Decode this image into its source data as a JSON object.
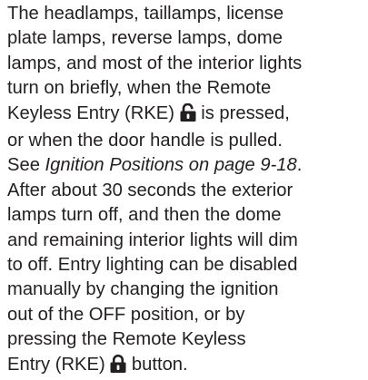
{
  "paragraph": {
    "lines": [
      "The headlamps, taillamps, license",
      "plate lamps, reverse lamps, dome",
      "lamps, and most of the interior lights",
      "turn on briefly, when the Remote",
      "Keyless Entry (RKE)",
      " is pressed,",
      "or when the door handle is pulled.",
      "See ",
      "Ignition Positions on page 9-18",
      ".",
      "After about 30 seconds the exterior",
      "lamps turn off, and then the dome",
      "and remaining interior lights will dim",
      "to off. Entry lighting can be disabled",
      "manually by changing the ignition",
      "out of the OFF position, or by",
      "pressing the Remote Keyless",
      "Entry (RKE)",
      " button."
    ]
  },
  "icons": {
    "unlock": "unlock-icon",
    "lock": "lock-icon"
  }
}
